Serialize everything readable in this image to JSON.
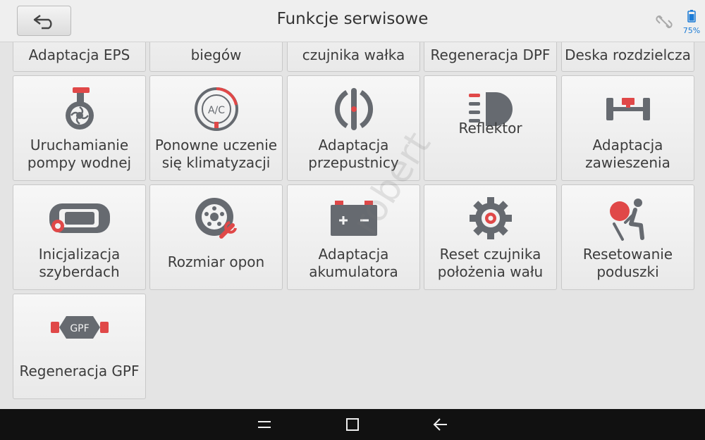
{
  "header": {
    "title": "Funkcje serwisowe",
    "battery_percent": "75%",
    "back_icon": "back-arrow-icon",
    "link_icon": "link-off-icon",
    "battery_icon": "battery-icon"
  },
  "tiles_partial": [
    {
      "label": "Adaptacja EPS"
    },
    {
      "label": "biegów"
    },
    {
      "label": "czujnika wałka"
    },
    {
      "label": "Regeneracja DPF"
    },
    {
      "label": "Deska rozdzielcza"
    }
  ],
  "tiles": [
    {
      "label": "Uruchamianie pompy wodnej",
      "icon": "water-pump-icon"
    },
    {
      "label": "Ponowne uczenie się klimatyzacji",
      "icon": "ac-icon",
      "icon_text": "A/C"
    },
    {
      "label": "Adaptacja przepustnicy",
      "icon": "throttle-icon"
    },
    {
      "label": "Reflektor",
      "icon": "headlight-icon"
    },
    {
      "label": "Adaptacja zawieszenia",
      "icon": "suspension-icon"
    },
    {
      "label": "Inicjalizacja szyberdach",
      "icon": "sunroof-icon"
    },
    {
      "label": "Rozmiar opon",
      "icon": "tire-icon"
    },
    {
      "label": "Adaptacja akumulatora",
      "icon": "battery-adapt-icon"
    },
    {
      "label": "Reset czujnika położenia wału",
      "icon": "gear-sensor-icon"
    },
    {
      "label": "Resetowanie poduszki",
      "icon": "airbag-icon"
    },
    {
      "label": "Regeneracja GPF",
      "icon": "gpf-icon",
      "icon_text": "GPF"
    }
  ],
  "watermark": "robert",
  "colors": {
    "accent_red": "#e04848",
    "icon_gray": "#666a70",
    "battery_blue": "#1b7bd6"
  }
}
